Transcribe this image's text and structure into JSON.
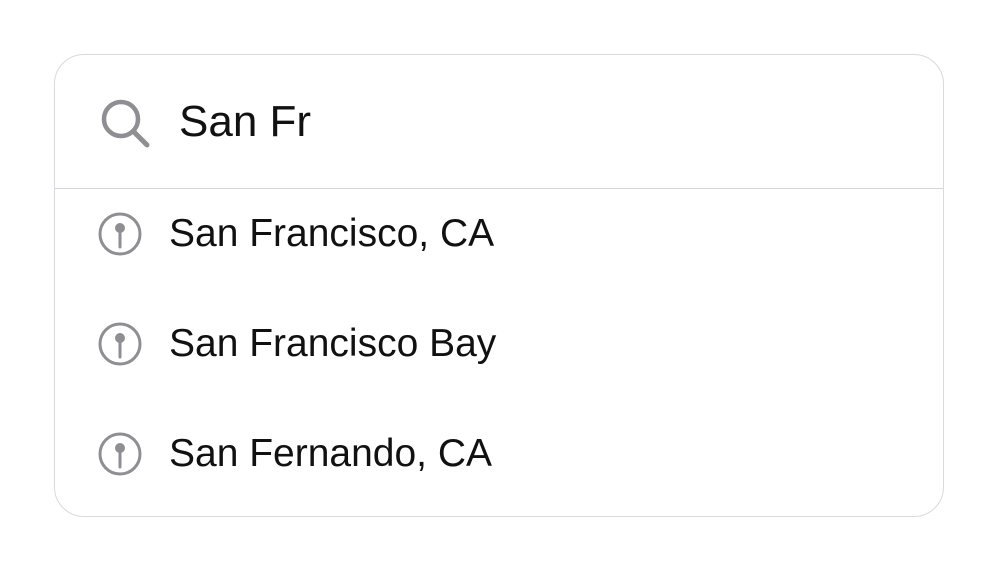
{
  "search": {
    "icon": "search-icon",
    "value": "San Fr",
    "placeholder": ""
  },
  "suggestions": [
    {
      "label": "San Francisco, CA",
      "icon": "map-pin-icon"
    },
    {
      "label": "San Francisco Bay",
      "icon": "map-pin-icon"
    },
    {
      "label": "San Fernando, CA",
      "icon": "map-pin-icon"
    }
  ],
  "colors": {
    "icon": "#8e8e93",
    "text": "#111111",
    "border": "#d9d9de"
  }
}
